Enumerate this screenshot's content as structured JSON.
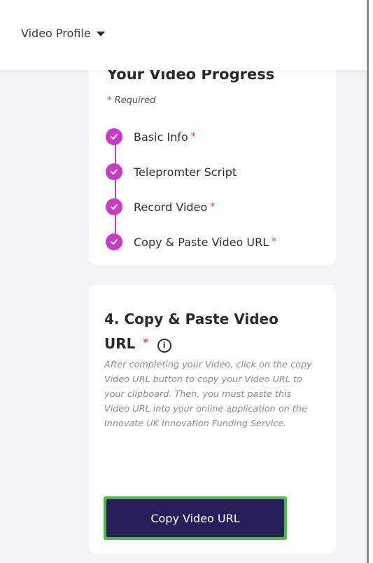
{
  "header": {
    "profile_menu_label": "Video Profile"
  },
  "progress": {
    "title": "Your Video Progress",
    "required_label": "Required",
    "required_marker": "*",
    "steps": [
      {
        "label": "Basic Info",
        "required": "*"
      },
      {
        "label": "Telepromter Script",
        "required": ""
      },
      {
        "label": "Record Video",
        "required": "*"
      },
      {
        "label": "Copy & Paste Video URL",
        "required": "*"
      }
    ]
  },
  "copy_section": {
    "title": "4. Copy & Paste Video URL",
    "required_marker": "*",
    "description": "After completing your Video, click on the copy Video URL button to copy your Video URL to your clipboard. Then, you must paste this Video URL into your online application on the Innovate UK Innovation Funding Service.",
    "button_label": "Copy Video URL"
  },
  "colors": {
    "accent_purple": "#c93bc6",
    "button_navy": "#261f5a",
    "focus_green": "#4fb94a",
    "required_red": "#e23a4a"
  },
  "icons": {
    "step_status": "check-circle-icon",
    "info": "info-icon",
    "menu": "caret-down-icon"
  }
}
